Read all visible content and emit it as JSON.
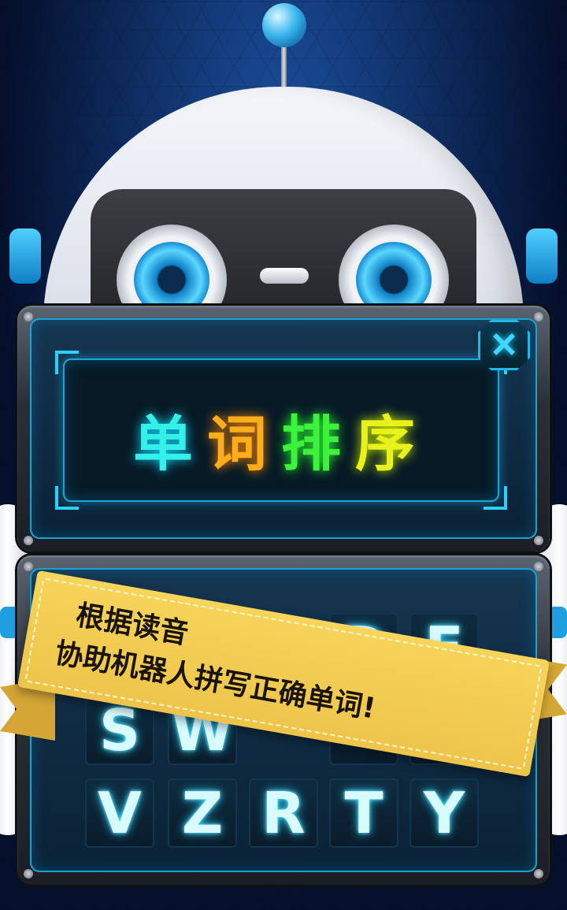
{
  "title": {
    "chars": [
      "单",
      "词",
      "排",
      "序"
    ]
  },
  "close_symbol": "✕",
  "tiles": [
    {
      "letter": ""
    },
    {
      "letter": ""
    },
    {
      "letter": "D"
    },
    {
      "letter": "E"
    },
    {
      "letter": "S"
    },
    {
      "letter": "W"
    },
    {
      "letter": ""
    },
    {
      "letter": ""
    },
    {
      "letter": "V"
    },
    {
      "letter": "Z"
    },
    {
      "letter": "R"
    },
    {
      "letter": "T"
    },
    {
      "letter": "Y"
    }
  ],
  "banner": {
    "line1": "根据读音",
    "line2": "协助机器人拼写正确单词!"
  },
  "colors": {
    "title_1": "#33f0e8",
    "title_2": "#ffae1a",
    "title_3": "#3cf23c",
    "title_4": "#eaf01a",
    "banner": "#f7d45a",
    "glow": "#2cd8ff"
  }
}
